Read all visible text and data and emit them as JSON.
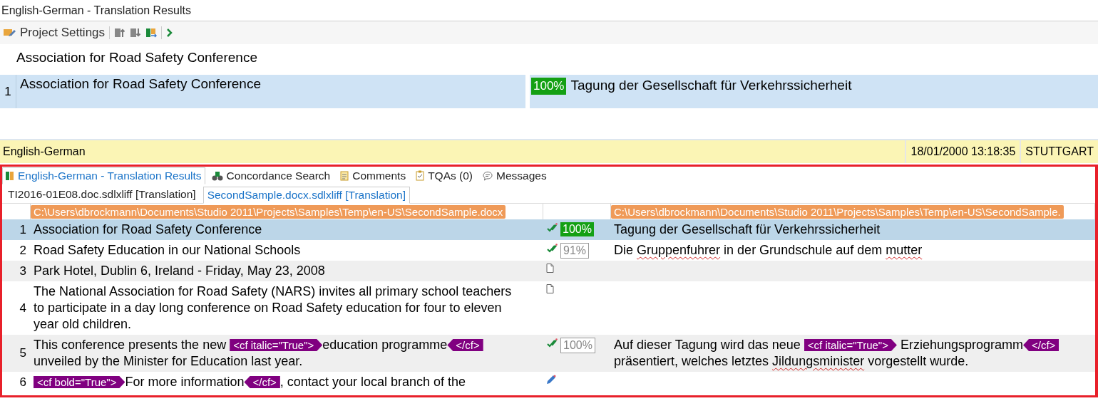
{
  "window": {
    "title": "English-German - Translation Results"
  },
  "toolbar": {
    "project_settings": "Project Settings"
  },
  "preview": {
    "text": "Association for Road Safety Conference"
  },
  "active_segment": {
    "number": "1",
    "source": "Association for Road Safety Conference",
    "match": "100%",
    "target": "Tagung der Gesellschaft für Verkehrssicherheit"
  },
  "info_bar": {
    "language": "English-German",
    "date": "18/01/2000 13:18:35",
    "location": "STUTTGART"
  },
  "results": {
    "tabs": [
      {
        "label": "English-German - Translation Results",
        "selected": true
      },
      {
        "label": "Concordance Search",
        "selected": false
      },
      {
        "label": "Comments",
        "selected": false
      },
      {
        "label": "TQAs (0)",
        "selected": false
      },
      {
        "label": "Messages",
        "selected": false
      }
    ],
    "file_tabs": [
      {
        "label": "TI2016-01E08.doc.sdlxliff [Translation]",
        "selected": false
      },
      {
        "label": "SecondSample.docx.sdlxliff [Translation]",
        "selected": true
      }
    ],
    "source_path": "C:\\Users\\dbrockmann\\Documents\\Studio 2011\\Projects\\Samples\\Temp\\en-US\\SecondSample.docx",
    "target_path": "C:\\Users\\dbrockmann\\Documents\\Studio 2011\\Projects\\Samples\\Temp\\en-US\\SecondSample.",
    "rows": [
      {
        "number": "1",
        "selected": true,
        "kind": "translated",
        "match": {
          "text": "100%",
          "kind": "filled"
        },
        "source": [
          {
            "kind": "text",
            "text": "Association for Road Safety Conference"
          }
        ],
        "target": [
          {
            "kind": "text",
            "text": "Tagung der Gesellschaft für Verkehrssicherheit"
          }
        ]
      },
      {
        "number": "2",
        "selected": false,
        "kind": "translated",
        "match": {
          "text": "91%",
          "kind": "outlined"
        },
        "source": [
          {
            "kind": "text",
            "text": "Road Safety Education in our National Schools"
          }
        ],
        "target": [
          {
            "kind": "text",
            "text": "Die "
          },
          {
            "kind": "misspelled",
            "text": "Gruppenfuhrer"
          },
          {
            "kind": "text",
            "text": " in der Grundschule auf dem "
          },
          {
            "kind": "misspelled",
            "text": "mutter"
          }
        ]
      },
      {
        "number": "3",
        "selected": false,
        "kind": "untranslated",
        "source": [
          {
            "kind": "text",
            "text": "Park Hotel, Dublin 6, Ireland - Friday, May 23, 2008"
          }
        ],
        "target": []
      },
      {
        "number": "4",
        "selected": false,
        "kind": "untranslated",
        "source": [
          {
            "kind": "text",
            "text": "The National Association for Road Safety (NARS) invites all primary school teachers to participate in a day long conference on Road Safety education for four to eleven year old children."
          }
        ],
        "target": []
      },
      {
        "number": "5",
        "selected": false,
        "kind": "translated",
        "match": {
          "text": "100%",
          "kind": "outlined"
        },
        "source": [
          {
            "kind": "text",
            "text": "This conference presents the new "
          },
          {
            "kind": "tag_open",
            "text": "<cf italic=\"True\">"
          },
          {
            "kind": "text",
            "text": "education programme"
          },
          {
            "kind": "tag_close",
            "text": "</cf>"
          },
          {
            "kind": "text",
            "text": " unveiled by the Minister for Education last year."
          }
        ],
        "target": [
          {
            "kind": "text",
            "text": "Auf dieser Tagung wird das neue "
          },
          {
            "kind": "tag_open",
            "text": "<cf italic=\"True\">"
          },
          {
            "kind": "text",
            "text": " Erziehungsprogramm"
          },
          {
            "kind": "tag_close",
            "text": "</cf>"
          },
          {
            "kind": "text",
            "text": " präsentiert, welches letztes "
          },
          {
            "kind": "misspelled",
            "text": "Jildungsminister"
          },
          {
            "kind": "text",
            "text": " vorgestellt wurde."
          }
        ]
      },
      {
        "number": "6",
        "selected": false,
        "kind": "draft",
        "source": [
          {
            "kind": "tag_open",
            "text": "<cf bold=\"True\">"
          },
          {
            "kind": "text",
            "text": "For more information"
          },
          {
            "kind": "tag_close",
            "text": "</cf>"
          },
          {
            "kind": "text",
            "text": ", contact your local branch of the"
          }
        ],
        "target": []
      }
    ]
  }
}
